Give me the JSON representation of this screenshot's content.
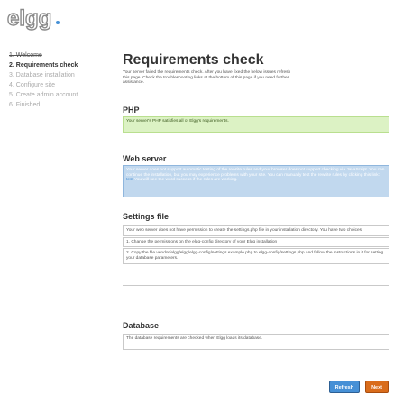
{
  "brand": {
    "logo_text": "elgg"
  },
  "steps": [
    {
      "label": "1. Welcome",
      "state": "done"
    },
    {
      "label": "2. Requirements check",
      "state": "current"
    },
    {
      "label": "3. Database installation",
      "state": "todo"
    },
    {
      "label": "4. Configure site",
      "state": "todo"
    },
    {
      "label": "5. Create admin account",
      "state": "todo"
    },
    {
      "label": "6. Finished",
      "state": "todo"
    }
  ],
  "main": {
    "title": "Requirements check",
    "intro": "Your server failed the requirements check. After you have fixed the below issues refresh this page. Check the troubleshooting links at the bottom of this page if you need further assistance."
  },
  "php": {
    "heading": "PHP",
    "message": "Your server's PHP satisfies all of Elgg's requirements."
  },
  "webserver": {
    "heading": "Web server",
    "message": "Your server does not support automatic testing of the rewrite rules and your browser does not support checking via JavaScript. You can continue the installation, but you may experience problems with your site. You can manually test the rewrite rules by clicking this link:",
    "link_text": "test",
    "message_end": "You will see the word success if the rules are working."
  },
  "settings": {
    "heading": "Settings file",
    "msg1": "Your web server does not have permission to create the settings.php file in your installation directory. You have two choices:",
    "msg2": "1. Change the permissions on the elgg-config directory of your Elgg installation",
    "msg3": "2. Copy the file vendor/elgg/elgg/elgg-config/settings.example.php to elgg-config/settings.php and follow the instructions in it for setting your database parameters."
  },
  "database": {
    "heading": "Database",
    "message": "The database requirements are checked when Elgg loads its database."
  },
  "buttons": {
    "refresh": "Refresh",
    "next": "Next"
  },
  "colors": {
    "accent": "#4690d6",
    "next": "#d96c1b",
    "success_bg": "#dcf2c4",
    "error_bg": "#c1d8ee"
  }
}
